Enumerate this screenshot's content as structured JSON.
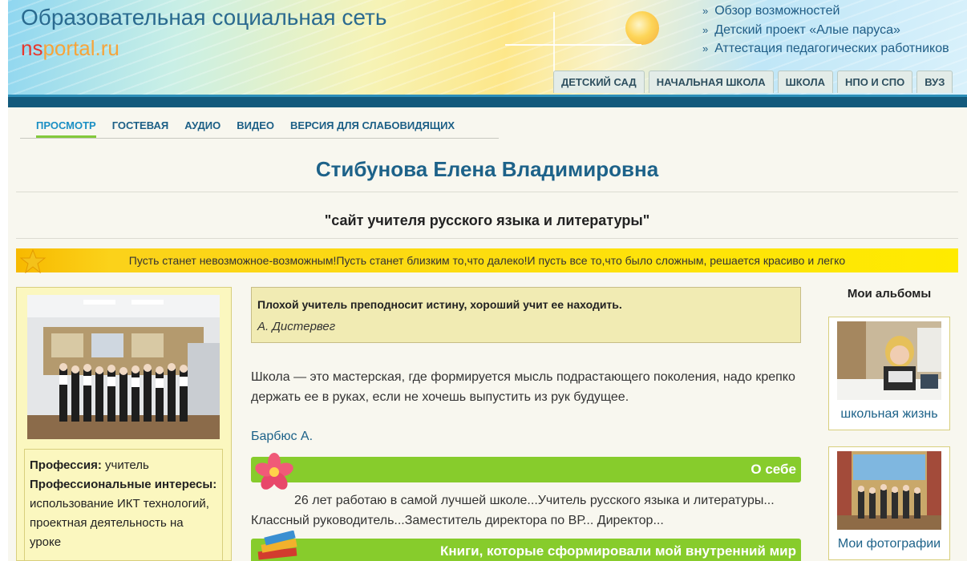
{
  "header": {
    "site_title": "Образовательная социальная сеть",
    "logo_ns": "ns",
    "logo_rest": "portal.ru",
    "links": [
      "Обзор возможностей",
      "Детский проект «Алые паруса»",
      "Аттестация педагогических работников"
    ],
    "tabs": [
      "ДЕТСКИЙ САД",
      "НАЧАЛЬНАЯ ШКОЛА",
      "ШКОЛА",
      "НПО И СПО",
      "ВУЗ"
    ]
  },
  "subnav": {
    "items": [
      "ПРОСМОТР",
      "ГОСТЕВАЯ",
      "АУДИО",
      "ВИДЕО",
      "ВЕРСИЯ ДЛЯ СЛАБОВИДЯЩИХ"
    ],
    "active": "ПРОСМОТР"
  },
  "page": {
    "title": "Стибунова Елена Владимировна",
    "subtitle": "\"сайт учителя русского языка и литературы\"",
    "motto": "Пусть станет невозможное-возможным!Пусть станет близким то,что далеко!И пусть все то,что было сложным, решается красиво и легко"
  },
  "profile": {
    "profession_label": "Профессия:",
    "profession_value": "учитель",
    "interests_label": "Профессиональные интересы:",
    "interests_value": "использование ИКТ технологий, проектная деятельность на уроке"
  },
  "quote": {
    "text": "Плохой учитель преподносит истину, хороший учит ее находить.",
    "author": "А. Дистервег"
  },
  "school_quote": {
    "text": "Школа — это мастерская, где формируется мысль подрастающего поколения, надо крепко держать ее в руках, если не хочешь выпустить из рук будущее.",
    "author": "Барбюс А."
  },
  "sections": {
    "about_title": "О себе",
    "about_text": "26 лет работаю в самой лучшей школе...Учитель русского языка и литературы... Классный руководитель...Заместитель директора по ВР... Директор...",
    "books_title": "Книги, которые сформировали мой внутренний мир"
  },
  "albums": {
    "title": "Мои альбомы",
    "items": [
      "школьная жизнь",
      "Мои фотографии"
    ]
  },
  "colors": {
    "accent_blue": "#1d6289",
    "band": "#135a7c",
    "green_bar": "#87cc2c",
    "motto_yellow": "#ffeb00"
  }
}
